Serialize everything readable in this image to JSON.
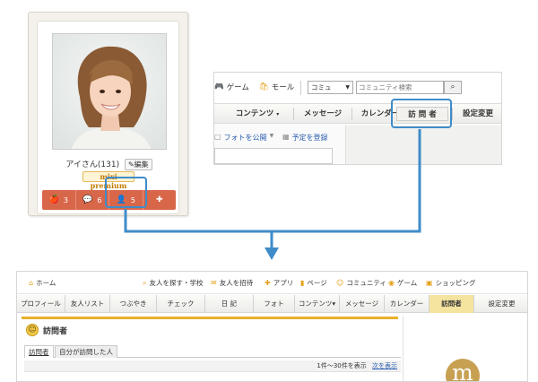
{
  "profile_card": {
    "name": "アイさん(131)",
    "edit_label": "編集",
    "premium_badge": "mixi premium",
    "activity": [
      {
        "icon": "apple-icon",
        "glyph": "🍎",
        "count": "3"
      },
      {
        "icon": "speech-icon",
        "glyph": "💬",
        "count": "6"
      },
      {
        "icon": "person-icon",
        "glyph": "👤",
        "count": "5"
      },
      {
        "icon": "puzzle-icon",
        "glyph": "✚",
        "count": ""
      }
    ]
  },
  "nav_snippet": {
    "topbar_items": [
      {
        "icon": "game-icon",
        "label": "ゲーム"
      },
      {
        "icon": "mall-icon",
        "label": "モール"
      }
    ],
    "search_select": "コミュ",
    "search_placeholder": "コミュニティ検索",
    "tabs": [
      "コンテンツ",
      "メッセージ",
      "カレンダー",
      "訪 問 者",
      "設定変更"
    ],
    "content_tabs_arrow": "▾",
    "links": [
      "フォトを公開",
      "予定を登録"
    ]
  },
  "full_page": {
    "topnav": [
      {
        "icon": "home-icon",
        "label": "ホーム"
      },
      {
        "icon": "search-icon",
        "label": "友人を探す・学校"
      },
      {
        "icon": "invite-icon",
        "label": "友人を招待"
      },
      {
        "icon": "app-icon",
        "label": "アプリ"
      },
      {
        "icon": "page-icon",
        "label": "ページ"
      },
      {
        "icon": "community-icon",
        "label": "コミュニティ"
      },
      {
        "icon": "game-icon",
        "label": "ゲーム"
      },
      {
        "icon": "shopping-icon",
        "label": "ショッピング"
      }
    ],
    "tabs": [
      "プロフィール",
      "友人リスト",
      "つぶやき",
      "チェック",
      "日 記",
      "フォト",
      "コンテンツ▾",
      "メッセージ",
      "カレンダー",
      "訪問者",
      "設定変更"
    ],
    "active_tab_index": 9,
    "section_title": "訪問者",
    "subtabs": [
      "訪問者",
      "自分が訪問した人"
    ],
    "pager_text": "1件〜30件を表示",
    "pager_next": "次を表示",
    "logo_letter": "m"
  },
  "colors": {
    "accent_blue": "#3f8cc9",
    "activity_red": "#d8674a",
    "tab_active": "#f5e3a0",
    "section_rule": "#e9b12a"
  }
}
